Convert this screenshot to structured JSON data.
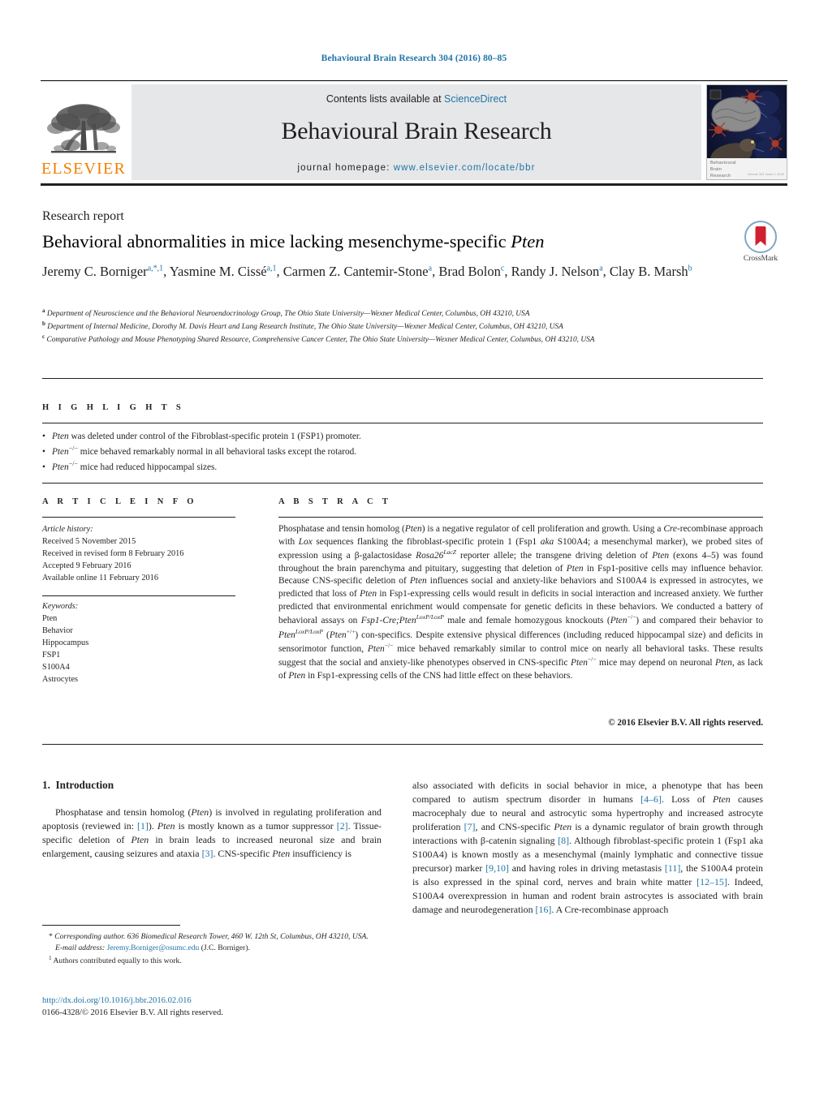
{
  "running_head": "Behavioural Brain Research 304 (2016) 80–85",
  "masthead": {
    "contents_prefix": "Contents lists available at ",
    "contents_link": "ScienceDirect",
    "journal_title": "Behavioural Brain Research",
    "homepage_prefix": "journal homepage: ",
    "homepage_url": "www.elsevier.com/locate/bbr",
    "publisher_name": "ELSEVIER",
    "cover_caption_line1": "Behavioural",
    "cover_caption_line2": "Brain",
    "cover_caption_line3": "Research",
    "cover_issue_text": "Volume 304  Issue 1  2016"
  },
  "article": {
    "type": "Research report",
    "title_main": "Behavioral abnormalities in mice lacking mesenchyme-specific ",
    "title_italic": "Pten",
    "crossmark_label": "CrossMark"
  },
  "authors": [
    {
      "name": "Jeremy C. Borniger",
      "marks": "a,*,1",
      "sep": ", "
    },
    {
      "name": "Yasmine M. Cissé",
      "marks": "a,1",
      "sep": ", "
    },
    {
      "name": "Carmen Z. Cantemir-Stone",
      "marks": "a",
      "sep": ", "
    },
    {
      "name": "Brad Bolon",
      "marks": "c",
      "sep": ", "
    },
    {
      "name": "Randy J. Nelson",
      "marks": "a",
      "sep": ", "
    },
    {
      "name": "Clay B. Marsh",
      "marks": "b",
      "sep": ""
    }
  ],
  "affiliations": [
    {
      "mark": "a",
      "text": "Department of Neuroscience and the Behavioral Neuroendocrinology Group, The Ohio State University—Wexner Medical Center, Columbus, OH 43210, USA"
    },
    {
      "mark": "b",
      "text": "Department of Internal Medicine, Dorothy M. Davis Heart and Lung Research Institute, The Ohio State University—Wexner Medical Center, Columbus, OH 43210, USA"
    },
    {
      "mark": "c",
      "text": "Comparative Pathology and Mouse Phenotyping Shared Resource, Comprehensive Cancer Center, The Ohio State University—Wexner Medical Center, Columbus, OH 43210, USA"
    }
  ],
  "highlights": {
    "header": "H I G H L I G H T S",
    "items": [
      "Pten was deleted under control of the Fibroblast-specific protein 1 (FSP1) promoter.",
      "Pten−/− mice behaved remarkably normal in all behavioral tasks except the rotarod.",
      "Pten−/− mice had reduced hippocampal sizes."
    ]
  },
  "article_info": {
    "header": "A R T I C L E   I N F O",
    "history_label": "Article history:",
    "history": [
      "Received 5 November 2015",
      "Received in revised form 8 February 2016",
      "Accepted 9 February 2016",
      "Available online 11 February 2016"
    ],
    "keywords_label": "Keywords:",
    "keywords": [
      "Pten",
      "Behavior",
      "Hippocampus",
      "FSP1",
      "S100A4",
      "Astrocytes"
    ]
  },
  "abstract": {
    "header": "A B S T R A C T",
    "text": "Phosphatase and tensin homolog (Pten) is a negative regulator of cell proliferation and growth. Using a Cre-recombinase approach with Lox sequences flanking the fibroblast-specific protein 1 (Fsp1 aka S100A4; a mesenchymal marker), we probed sites of expression using a β-galactosidase Rosa26LacZ reporter allele; the transgene driving deletion of Pten (exons 4–5) was found throughout the brain parenchyma and pituitary, suggesting that deletion of Pten in Fsp1-positive cells may influence behavior. Because CNS-specific deletion of Pten influences social and anxiety-like behaviors and S100A4 is expressed in astrocytes, we predicted that loss of Pten in Fsp1-expressing cells would result in deficits in social interaction and increased anxiety. We further predicted that environmental enrichment would compensate for genetic deficits in these behaviors. We conducted a battery of behavioral assays on Fsp1-Cre;PtenLoxP/LoxP male and female homozygous knockouts (Pten−/−) and compared their behavior to PtenLoxP/LoxP (Pten+/+) con-specifics. Despite extensive physical differences (including reduced hippocampal size) and deficits in sensorimotor function, Pten−/− mice behaved remarkably similar to control mice on nearly all behavioral tasks. These results suggest that the social and anxiety-like phenotypes observed in CNS-specific Pten−/− mice may depend on neuronal Pten, as lack of Pten in Fsp1-expressing cells of the CNS had little effect on these behaviors.",
    "copyright": "© 2016 Elsevier B.V. All rights reserved."
  },
  "body": {
    "section_number": "1.",
    "section_title": "Introduction",
    "left_column": "Phosphatase and tensin homolog (Pten) is involved in regulating proliferation and apoptosis (reviewed in: [1]). Pten is mostly known as a tumor suppressor [2]. Tissue-specific deletion of Pten in brain leads to increased neuronal size and brain enlargement, causing seizures and ataxia [3]. CNS-specific Pten insufficiency is",
    "right_column": "also associated with deficits in social behavior in mice, a phenotype that has been compared to autism spectrum disorder in humans [4–6]. Loss of Pten causes macrocephaly due to neural and astrocytic soma hypertrophy and increased astrocyte proliferation [7], and CNS-specific Pten is a dynamic regulator of brain growth through interactions with β-catenin signaling [8]. Although fibroblast-specific protein 1 (Fsp1 aka S100A4) is known mostly as a mesenchymal (mainly lymphatic and connective tissue precursor) marker [9,10] and having roles in driving metastasis [11], the S100A4 protein is also expressed in the spinal cord, nerves and brain white matter [12–15]. Indeed, S100A4 overexpression in human and rodent brain astrocytes is associated with brain damage and neurodegeneration [16]. A Cre-recombinase approach"
  },
  "footnotes": {
    "corresponding": "Corresponding author. 636 Biomedical Research Tower, 460 W. 12th St, Columbus, OH 43210, USA.",
    "email_label": "E-mail address:",
    "email": "Jeremy.Borniger@osumc.edu",
    "email_owner": "(J.C. Borniger).",
    "equal_contribution": "Authors contributed equally to this work.",
    "doi": "http://dx.doi.org/10.1016/j.bbr.2016.02.016",
    "issn_line": "0166-4328/© 2016 Elsevier B.V. All rights reserved."
  },
  "colors": {
    "link": "#1f74a8",
    "elsevier_orange": "#f08000",
    "masthead_grey": "#e6e7e8",
    "rule_black": "#231f20"
  }
}
